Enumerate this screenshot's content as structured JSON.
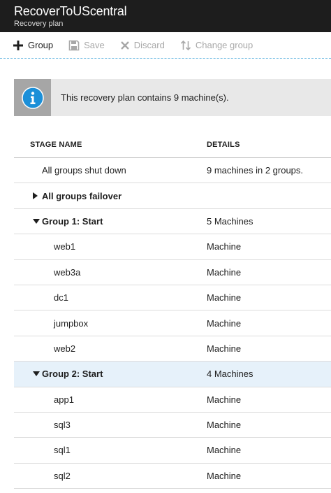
{
  "header": {
    "title": "RecoverToUScentral",
    "subtitle": "Recovery plan"
  },
  "toolbar": {
    "group_label": "Group",
    "save_label": "Save",
    "discard_label": "Discard",
    "change_group_label": "Change group"
  },
  "banner": {
    "icon": "info-icon",
    "message": "This recovery plan contains 9 machine(s)."
  },
  "table": {
    "headers": {
      "stage": "STAGE NAME",
      "details": "DETAILS"
    },
    "rows": [
      {
        "name": "All groups shut down",
        "details": "9 machines in 2 groups."
      },
      {
        "name": "All groups failover",
        "details": ""
      },
      {
        "name": "Group 1: Start",
        "details": "5 Machines"
      },
      {
        "name": "web1",
        "details": "Machine"
      },
      {
        "name": "web3a",
        "details": "Machine"
      },
      {
        "name": "dc1",
        "details": "Machine"
      },
      {
        "name": "jumpbox",
        "details": "Machine"
      },
      {
        "name": "web2",
        "details": "Machine"
      },
      {
        "name": "Group 2: Start",
        "details": "4 Machines"
      },
      {
        "name": "app1",
        "details": "Machine"
      },
      {
        "name": "sql3",
        "details": "Machine"
      },
      {
        "name": "sql1",
        "details": "Machine"
      },
      {
        "name": "sql2",
        "details": "Machine"
      }
    ]
  }
}
